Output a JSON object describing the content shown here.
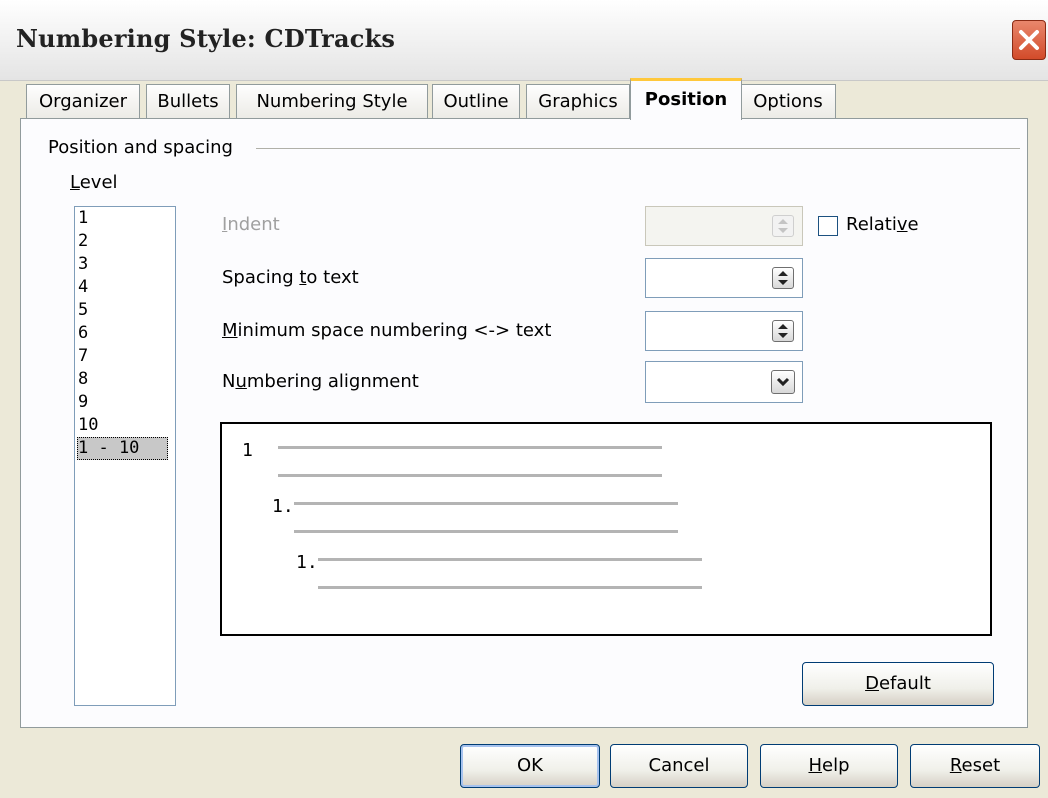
{
  "window": {
    "title": "Numbering Style: CDTracks"
  },
  "tabs": [
    {
      "label": "Organizer"
    },
    {
      "label": "Bullets"
    },
    {
      "label": "Numbering Style"
    },
    {
      "label": "Outline"
    },
    {
      "label": "Graphics"
    },
    {
      "label": "Position",
      "active": true
    },
    {
      "label": "Options"
    }
  ],
  "position_panel": {
    "group_label": "Position and spacing",
    "level_label": "Level",
    "levels": [
      "1",
      "2",
      "3",
      "4",
      "5",
      "6",
      "7",
      "8",
      "9",
      "10",
      "1 - 10"
    ],
    "selected_level": "1 - 10",
    "indent_label": "Indent",
    "indent_value": "",
    "relative_label": "Relative",
    "relative_checked": false,
    "spacing_label": "Spacing to text",
    "spacing_value": "",
    "min_space_label": "Minimum space numbering <-> text",
    "min_space_value": "",
    "alignment_label": "Numbering alignment",
    "alignment_value": "",
    "preview_numbers": [
      "1",
      "1.",
      "1."
    ],
    "default_button": "Default"
  },
  "buttons": {
    "ok": "OK",
    "cancel": "Cancel",
    "help": "Help",
    "reset": "Reset"
  },
  "colors": {
    "dialog_bg": "#ece9d8",
    "active_tab_accent": "#ffc83c",
    "close_button": "#d24b2a"
  }
}
